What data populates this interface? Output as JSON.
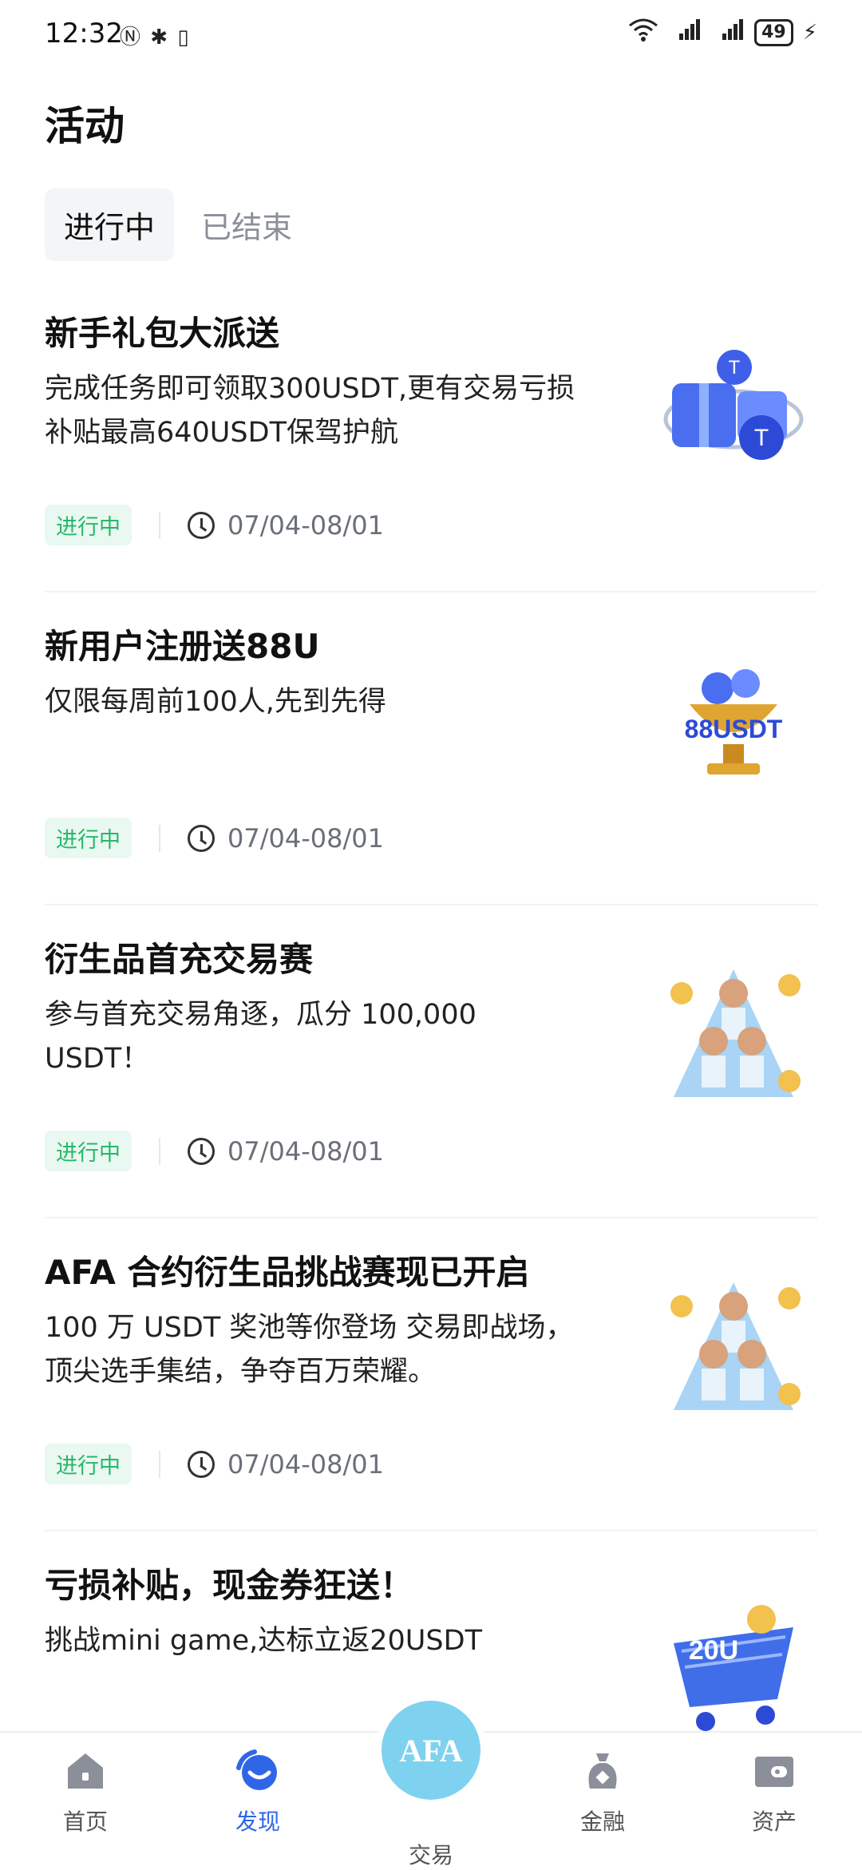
{
  "status_bar": {
    "time": "12:32",
    "battery": "49"
  },
  "page": {
    "title": "活动"
  },
  "tabs": [
    {
      "label": "进行中",
      "active": true
    },
    {
      "label": "已结束",
      "active": false
    }
  ],
  "activities": [
    {
      "title": "新手礼包大派送",
      "desc": "完成任务即可领取300USDT,更有交易亏损补贴最高640USDT保驾护航",
      "badge": "进行中",
      "date": "07/04-08/01",
      "image": "gift-box-usdt"
    },
    {
      "title": "新用户注册送88U",
      "desc": "仅限每周前100人,先到先得",
      "badge": "进行中",
      "date": "07/04-08/01",
      "image": "trophy-88usdt"
    },
    {
      "title": " 衍生品首充交易赛",
      "desc": "参与首充交易角逐，瓜分 100,000 USDT！",
      "badge": "进行中",
      "date": "07/04-08/01",
      "image": "football-players"
    },
    {
      "title": "AFA 合约衍生品挑战赛现已开启",
      "desc": "100 万 USDT 奖池等你登场 交易即战场，顶尖选手集结，争夺百万荣耀。",
      "badge": "进行中",
      "date": "07/04-08/01",
      "image": "football-players"
    },
    {
      "title": "亏损补贴，现金券狂送！",
      "desc": "挑战mini game,达标立返20USDT",
      "badge": "",
      "date": "",
      "image": "shopping-cart-20u"
    }
  ],
  "nav": {
    "home": "首页",
    "discover": "发现",
    "trade": "交易",
    "trade_logo": "AFA",
    "finance": "金融",
    "assets": "资产"
  },
  "colors": {
    "accent": "#2f66e8",
    "badge_text": "#25b86a",
    "badge_bg": "#e9f8f0",
    "trade_bg": "#7ed2ef"
  }
}
